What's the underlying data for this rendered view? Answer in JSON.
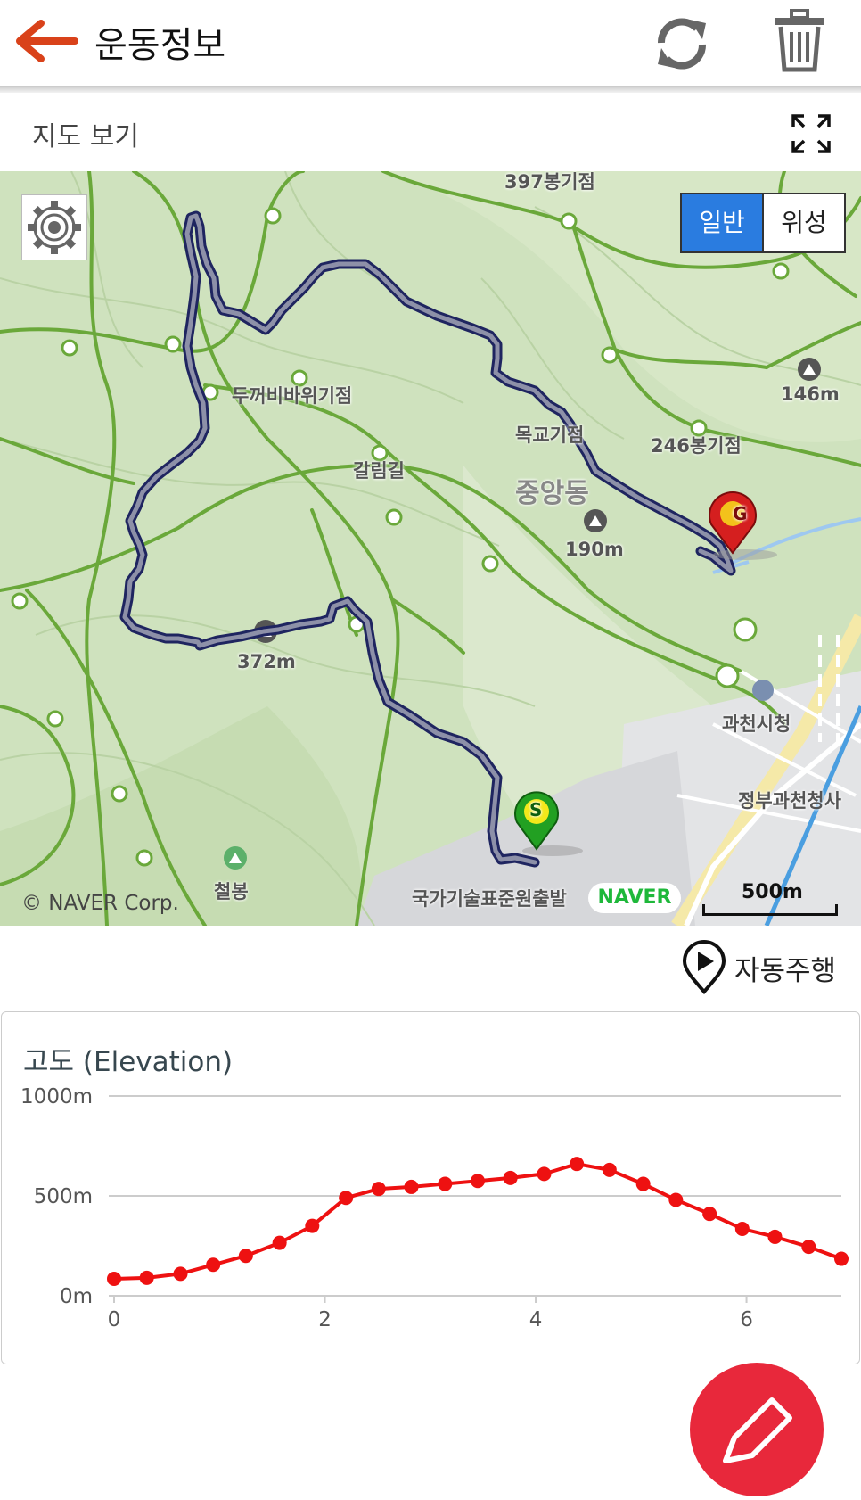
{
  "header": {
    "title": "운동정보",
    "colors": {
      "back_arrow": "#d9421a",
      "icon_gray": "#666666"
    }
  },
  "map_section": {
    "label": "지도 보기",
    "map_type": {
      "normal": "일반",
      "satellite": "위성",
      "selected": "일반"
    },
    "labels": {
      "peak_397": "397봉기점",
      "toad_rock": "두꺼비바위기점",
      "galrim": "갈림길",
      "mokgyo": "목교기점",
      "peak_246": "246봉기점",
      "jungang": "중앙동",
      "summit_190": "190m",
      "summit_146": "146m",
      "summit_372": "372m",
      "city_hall": "과천시청",
      "gov_complex": "정부과천청사",
      "institute": "국가기술표준원출발",
      "cheolbong": "철봉"
    },
    "copyright": "© NAVER Corp.",
    "provider": "NAVER",
    "scale": "500m",
    "markers": {
      "start": "S",
      "goal": "G"
    },
    "colors": {
      "track": "#5e6178",
      "goal": "#d51f1f",
      "start": "#22a022",
      "selected_tab": "#2a7ce0"
    }
  },
  "autoplay": {
    "label": "자동주행"
  },
  "chart_data": {
    "type": "line",
    "title": "고도 (Elevation)",
    "y_tick_labels": [
      "1000m",
      "500m",
      "0m"
    ],
    "x_ticks": [
      0,
      2,
      4,
      6
    ],
    "xlim": [
      0,
      6.9
    ],
    "ylim": [
      0,
      1000
    ],
    "grid": true,
    "line_color": "#ee1111",
    "x": [
      0,
      0.31,
      0.63,
      0.94,
      1.25,
      1.57,
      1.88,
      2.2,
      2.51,
      2.82,
      3.14,
      3.45,
      3.76,
      4.08,
      4.39,
      4.7,
      5.02,
      5.33,
      5.65,
      5.96,
      6.27,
      6.59,
      6.9
    ],
    "values": [
      85,
      90,
      110,
      155,
      200,
      265,
      350,
      490,
      535,
      545,
      560,
      575,
      590,
      610,
      660,
      630,
      560,
      480,
      410,
      335,
      295,
      245,
      185
    ]
  }
}
